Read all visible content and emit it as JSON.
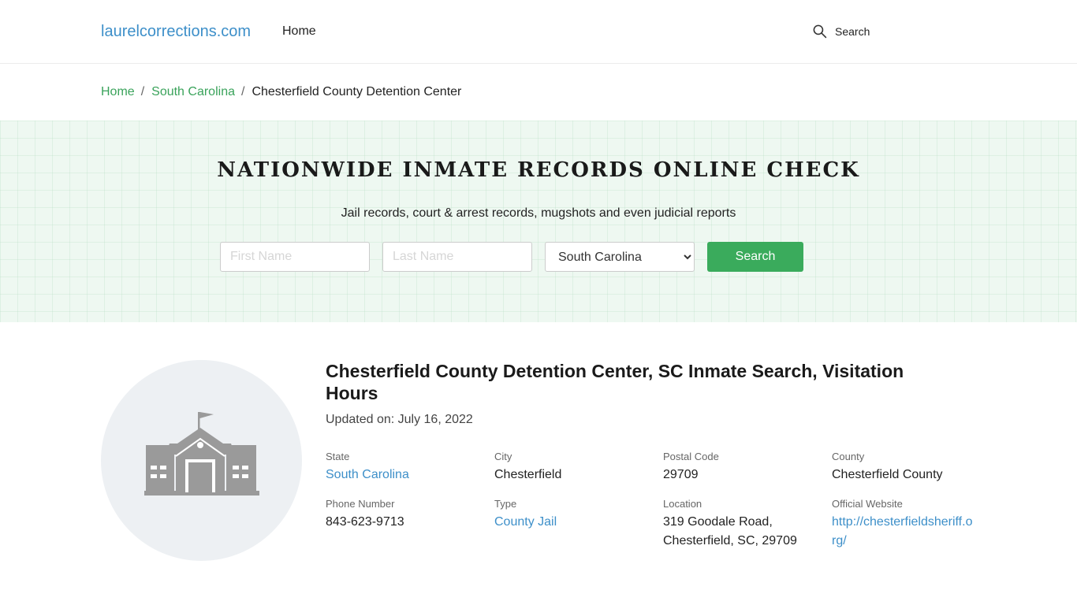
{
  "header": {
    "logo": "laurelcorrections.com",
    "nav_home": "Home",
    "search_label": "Search"
  },
  "breadcrumb": {
    "home": "Home",
    "state": "South Carolina",
    "current": "Chesterfield County Detention Center",
    "separator": "/"
  },
  "hero": {
    "title": "NATIONWIDE INMATE RECORDS ONLINE CHECK",
    "subtitle": "Jail records, court & arrest records, mugshots and even judicial reports",
    "first_name_placeholder": "First Name",
    "last_name_placeholder": "Last Name",
    "state_selected": "South Carolina",
    "search_button": "Search"
  },
  "facility": {
    "title": "Chesterfield County Detention Center, SC Inmate Search, Visitation Hours",
    "updated": "Updated on: July 16, 2022",
    "fields": {
      "state_label": "State",
      "state_value": "South Carolina",
      "city_label": "City",
      "city_value": "Chesterfield",
      "postal_label": "Postal Code",
      "postal_value": "29709",
      "county_label": "County",
      "county_value": "Chesterfield County",
      "phone_label": "Phone Number",
      "phone_value": "843-623-9713",
      "type_label": "Type",
      "type_value": "County Jail",
      "location_label": "Location",
      "location_line1": "319 Goodale Road,",
      "location_line2": "Chesterfield, SC, 29709",
      "website_label": "Official Website",
      "website_line1": "http://chesterfieldsheriff.o",
      "website_line2": "rg/"
    }
  },
  "icons": {
    "search": "search-icon",
    "building": "building-icon"
  },
  "colors": {
    "link_blue": "#3d8fc9",
    "link_green": "#3aa35b",
    "button_green": "#3aab5c",
    "hero_bg": "#eef8f1"
  }
}
